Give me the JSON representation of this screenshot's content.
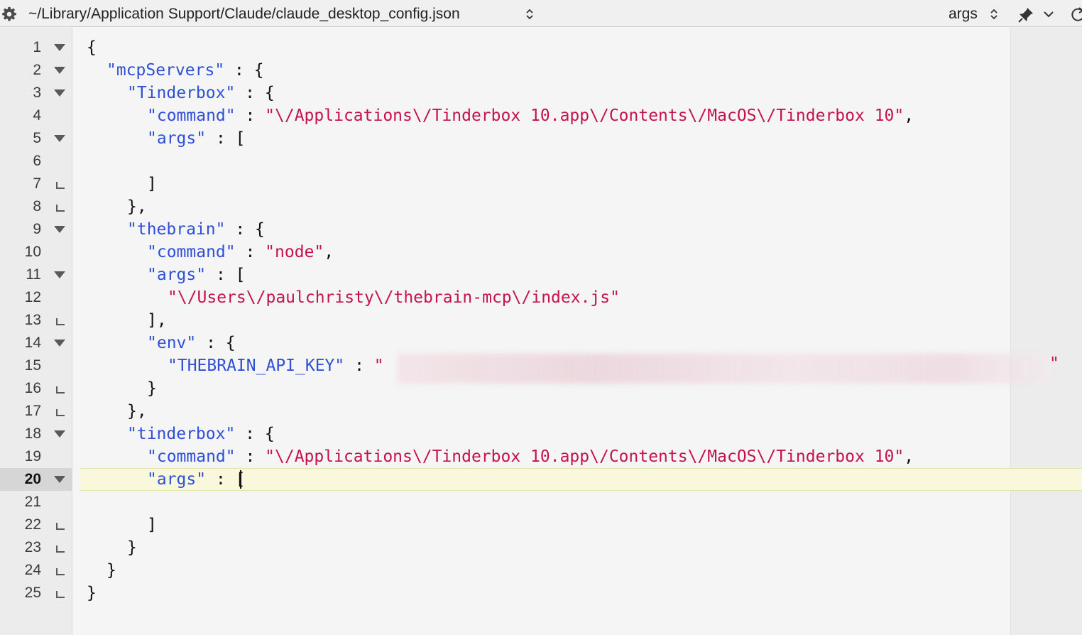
{
  "toolbar": {
    "file_path": "~/Library/Application Support/Claude/claude_desktop_config.json",
    "symbol": "args"
  },
  "editor": {
    "current_line": 20,
    "lines": [
      {
        "n": "1"
      },
      {
        "n": "2"
      },
      {
        "n": "3"
      },
      {
        "n": "4"
      },
      {
        "n": "5"
      },
      {
        "n": "6"
      },
      {
        "n": "7"
      },
      {
        "n": "8"
      },
      {
        "n": "9"
      },
      {
        "n": "10"
      },
      {
        "n": "11"
      },
      {
        "n": "12"
      },
      {
        "n": "13"
      },
      {
        "n": "14"
      },
      {
        "n": "15"
      },
      {
        "n": "16"
      },
      {
        "n": "17"
      },
      {
        "n": "18"
      },
      {
        "n": "19"
      },
      {
        "n": "20"
      },
      {
        "n": "21"
      },
      {
        "n": "22"
      },
      {
        "n": "23"
      },
      {
        "n": "24"
      },
      {
        "n": "25"
      }
    ],
    "code": {
      "l1_brace": "{",
      "l2_key": "\"mcpServers\"",
      "l2_rest": " : {",
      "l3_key": "\"Tinderbox\"",
      "l3_rest": " : {",
      "l4_key": "\"command\"",
      "l4_sep": " : ",
      "l4_val": "\"\\/Applications\\/Tinderbox 10.app\\/Contents\\/MacOS\\/Tinderbox 10\"",
      "l4_end": ",",
      "l5_key": "\"args\"",
      "l5_rest": " : [",
      "l7": "]",
      "l8": "},",
      "l9_key": "\"thebrain\"",
      "l9_rest": " : {",
      "l10_key": "\"command\"",
      "l10_sep": " : ",
      "l10_val": "\"node\"",
      "l10_end": ",",
      "l11_key": "\"args\"",
      "l11_rest": " : [",
      "l12_val": "\"\\/Users\\/paulchristy\\/thebrain-mcp\\/index.js\"",
      "l13": "],",
      "l14_key": "\"env\"",
      "l14_rest": " : {",
      "l15_key": "\"THEBRAIN_API_KEY\"",
      "l15_sep": " : ",
      "l15_val": "\"",
      "l15_end": "\"",
      "l16": "}",
      "l17": "},",
      "l18_key": "\"tinderbox\"",
      "l18_rest": " : {",
      "l19_key": "\"command\"",
      "l19_sep": " : ",
      "l19_val": "\"\\/Applications\\/Tinderbox 10.app\\/Contents\\/MacOS\\/Tinderbox 10\"",
      "l19_end": ",",
      "l20_key": "\"args\"",
      "l20_sep": " : ",
      "l20_rest": "[",
      "l22": "]",
      "l23": "}",
      "l24": "}",
      "l25": "}"
    }
  }
}
